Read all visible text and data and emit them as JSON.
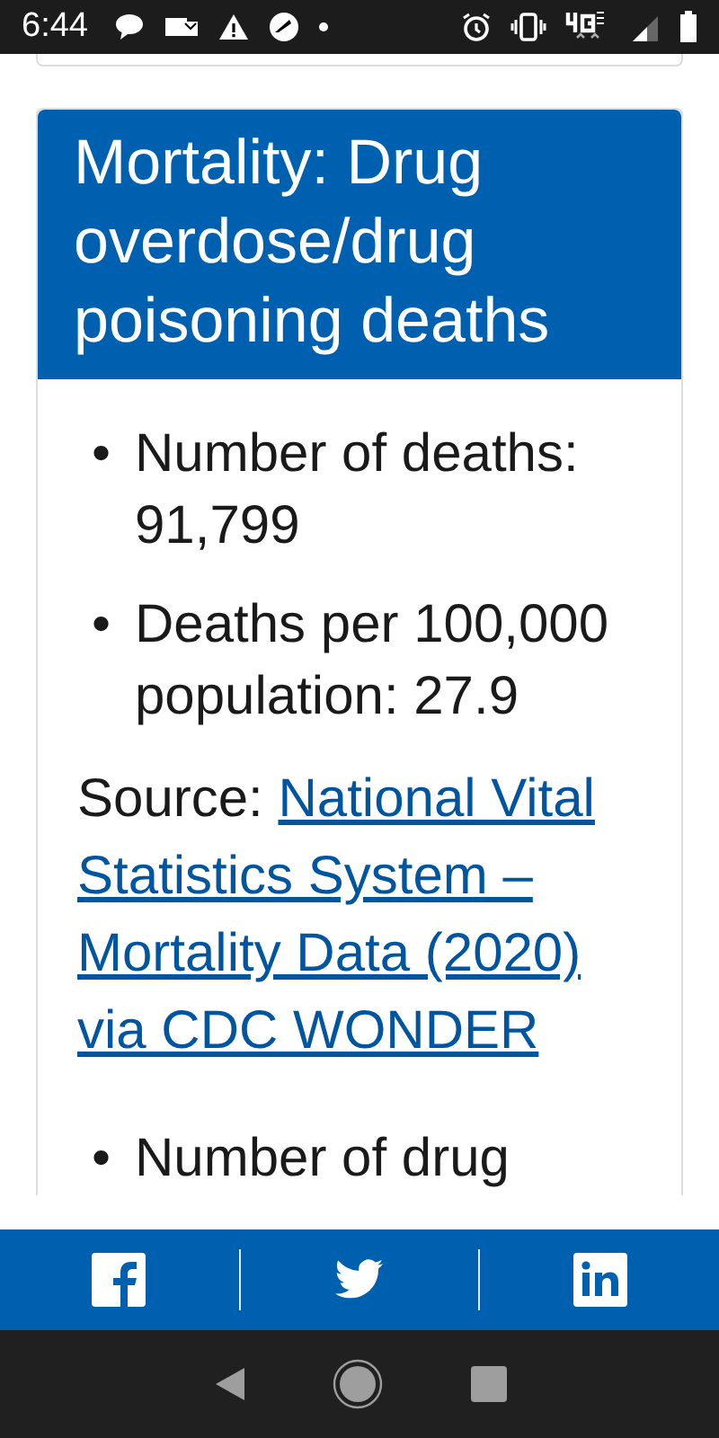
{
  "status_bar": {
    "time": "6:44"
  },
  "card": {
    "title": "Mortality: Drug overdose/drug poisoning deaths",
    "items": [
      {
        "marker": "•",
        "text": "Number of deaths: 91,799"
      },
      {
        "marker": "•",
        "text": "Deaths per 100,000 population: 27.9"
      }
    ],
    "source": {
      "label": "Source:",
      "link": "National Vital Statistics System – Mortality Data (2020) via CDC WONDER"
    },
    "more_items": [
      {
        "marker": "•",
        "text": "Number of drug"
      }
    ]
  }
}
